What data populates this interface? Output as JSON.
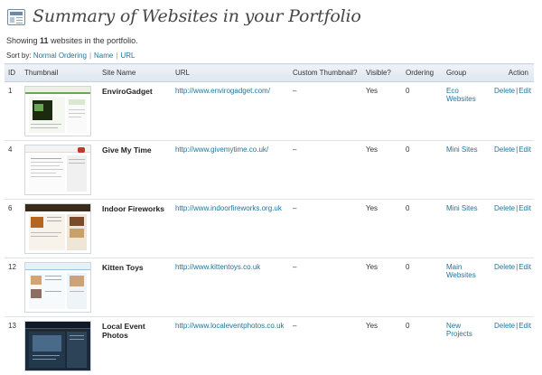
{
  "header": {
    "title": "Summary of Websites in your Portfolio",
    "icon": "page-layout-icon"
  },
  "summary": {
    "prefix": "Showing",
    "count": "11",
    "suffix": "websites in the portfolio."
  },
  "sort": {
    "label": "Sort by:",
    "options": [
      "Normal Ordering",
      "Name",
      "URL"
    ],
    "separator": "|"
  },
  "table": {
    "columns": [
      "ID",
      "Thumbnail",
      "Site Name",
      "URL",
      "Custom Thumbnail?",
      "Visible?",
      "Ordering",
      "Group",
      "Action"
    ],
    "action_labels": {
      "delete": "Delete",
      "edit": "Edit",
      "separator": "|"
    },
    "rows": [
      {
        "id": "1",
        "name": "EnviroGadget",
        "url": "http://www.envirogadget.com/",
        "custom_thumb": "–",
        "visible": "Yes",
        "ordering": "0",
        "group": "Eco Websites"
      },
      {
        "id": "4",
        "name": "Give My Time",
        "url": "http://www.givemytime.co.uk/",
        "custom_thumb": "–",
        "visible": "Yes",
        "ordering": "0",
        "group": "Mini Sites"
      },
      {
        "id": "6",
        "name": "Indoor Fireworks",
        "url": "http://www.indoorfireworks.org.uk",
        "custom_thumb": "–",
        "visible": "Yes",
        "ordering": "0",
        "group": "Mini Sites"
      },
      {
        "id": "12",
        "name": "Kitten Toys",
        "url": "http://www.kittentoys.co.uk",
        "custom_thumb": "–",
        "visible": "Yes",
        "ordering": "0",
        "group": "Main Websites"
      },
      {
        "id": "13",
        "name": "Local Event Photos",
        "url": "http://www.localeventphotos.co.uk",
        "custom_thumb": "–",
        "visible": "Yes",
        "ordering": "0",
        "group": "New Projects"
      }
    ]
  },
  "colors": {
    "link": "#21759b",
    "header_bg": "#e4ebf2",
    "title": "#464646"
  }
}
